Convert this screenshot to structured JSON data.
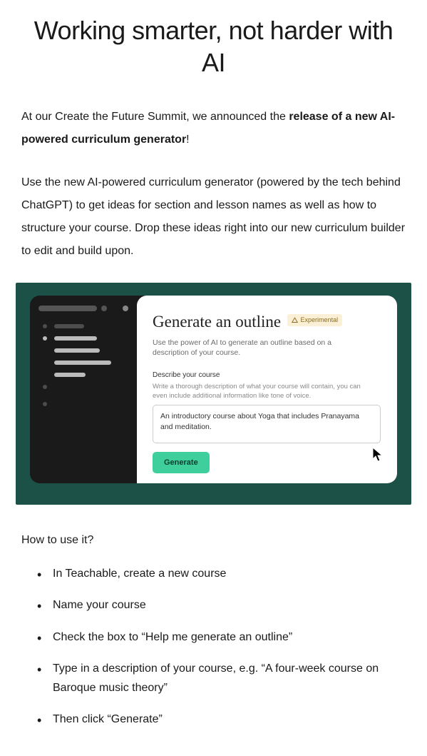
{
  "title": "Working smarter, not harder with AI",
  "intro": {
    "prefix": "At our Create the Future Summit, we announced the ",
    "bold": "release of a new AI-powered curriculum generator",
    "suffix": "!"
  },
  "para2": "Use the new AI-powered curriculum generator (powered by the tech behind ChatGPT) to get ideas for section and lesson names as well as how to structure your course. Drop these ideas right into our new curriculum builder to edit and build upon.",
  "embed": {
    "heading": "Generate an outline",
    "badge": "Experimental",
    "sub": "Use the power of AI to generate an outline based on a description of your course.",
    "label": "Describe your course",
    "hint": "Write a thorough description of what your course will contain, you can even include additional information like tone of voice.",
    "textarea_value": "An introductory course about Yoga that includes Pranayama and meditation.",
    "button": "Generate"
  },
  "howto_title": "How to use it?",
  "steps": [
    "In Teachable, create a new course",
    "Name your course",
    "Check the box to “Help me generate an outline”",
    "Type in a description of your course, e.g. “A four-week course on Baroque music theory”",
    "Then click “Generate”"
  ]
}
